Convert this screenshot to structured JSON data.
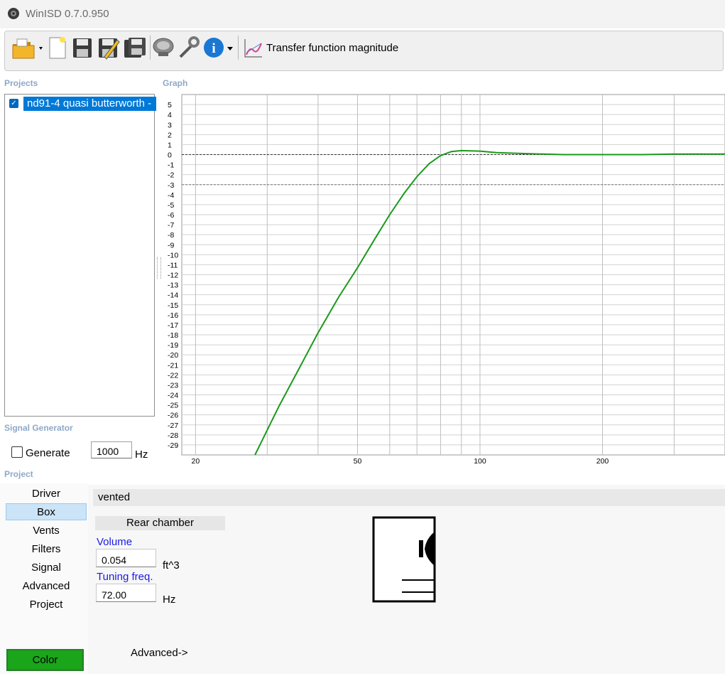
{
  "window": {
    "title": "WinISD 0.7.0.950",
    "app_icon": "speaker-icon"
  },
  "toolbar": {
    "buttons": [
      "open-folder-icon",
      "new-project-icon",
      "save-icon",
      "save-as-icon",
      "save-all-icon",
      "driver-icon",
      "tools-wrench-icon",
      "info-icon",
      "graph-icon"
    ],
    "graph_type": "Transfer function magnitude"
  },
  "sections": {
    "projects": "Projects",
    "graph": "Graph",
    "signal_generator": "Signal Generator",
    "project": "Project"
  },
  "projects": [
    {
      "name": "nd91-4 quasi butterworth -",
      "checked": true
    }
  ],
  "signal_generator": {
    "generate_label": "Generate",
    "checked": false,
    "frequency": "1000",
    "unit": "Hz"
  },
  "chart_data": {
    "type": "line",
    "title": "",
    "xlabel": "",
    "ylabel": "",
    "x_scale": "log",
    "x_ticks": [
      20,
      50,
      100,
      200
    ],
    "y_ticks": [
      5,
      4,
      3,
      2,
      1,
      0,
      -1,
      -2,
      -3,
      -4,
      -5,
      -6,
      -7,
      -8,
      -9,
      -10,
      -11,
      -12,
      -13,
      -14,
      -15,
      -16,
      -17,
      -18,
      -19,
      -20,
      -21,
      -22,
      -23,
      -24,
      -25,
      -26,
      -27,
      -28,
      -29
    ],
    "ylim": [
      -30,
      6
    ],
    "xlim": [
      18.5,
      400
    ],
    "grid": true,
    "reference_lines": [
      0,
      -3
    ],
    "series": [
      {
        "color": "#1a9a1a",
        "x": [
          28,
          32,
          36,
          40,
          45,
          50,
          55,
          60,
          65,
          70,
          75,
          80,
          85,
          90,
          100,
          110,
          130,
          160,
          200,
          250,
          300,
          400
        ],
        "y": [
          -30,
          -25.2,
          -21.3,
          -17.8,
          -14.2,
          -11.3,
          -8.5,
          -6.0,
          -3.9,
          -2.2,
          -0.9,
          -0.1,
          0.3,
          0.4,
          0.35,
          0.2,
          0.1,
          0.0,
          0.0,
          0.0,
          0.05,
          0.05
        ]
      }
    ]
  },
  "nav": {
    "items": [
      "Driver",
      "Box",
      "Vents",
      "Filters",
      "Signal",
      "Advanced",
      "Project"
    ],
    "active": "Box",
    "color_button": "Color",
    "color_value": "#1aa51a"
  },
  "box": {
    "type": "vented",
    "rear_chamber": "Rear chamber",
    "volume_label": "Volume",
    "volume": "0.054",
    "volume_unit": "ft^3",
    "tuning_label": "Tuning freq.",
    "tuning": "72.00",
    "tuning_unit": "Hz",
    "advanced_link": "Advanced->"
  }
}
